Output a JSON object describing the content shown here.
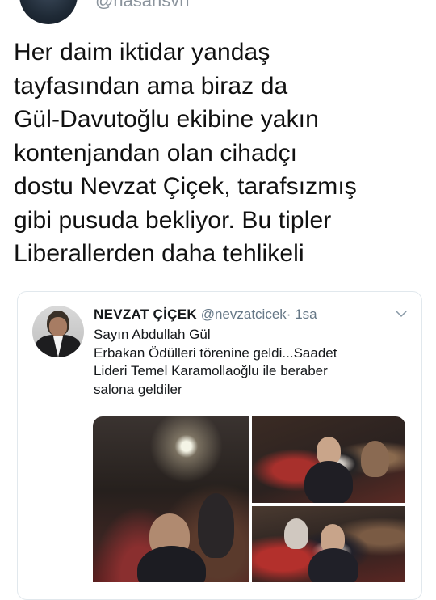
{
  "retweeter": {
    "handle": "@hasansvh"
  },
  "tweet": {
    "text": "Her daim iktidar yandaş\ntayfasından ama biraz da\nGül-Davutoğlu ekibine yakın\nkontenjandan olan cihadçı\ndostu Nevzat Çiçek, tarafsızmış\ngibi pusuda bekliyor. Bu tipler\nLiberallerden daha tehlikeli"
  },
  "quoted": {
    "name": "NEVZAT ÇİÇEK",
    "handle": "@nevzatcicek",
    "separator": "·",
    "time": "1sa",
    "text": "Sayın Abdullah Gül\nErbakan Ödülleri törenine geldi...Saadet\nLideri Temel Karamollaoğlu ile beraber\nsalona geldiler",
    "photos": [
      {
        "subject": "event-hall-crowd"
      },
      {
        "subject": "seated-guests"
      },
      {
        "subject": "seated-guests-closeup"
      }
    ]
  },
  "colors": {
    "text": "#14171a",
    "muted": "#657786",
    "border": "#e1e8ed"
  }
}
